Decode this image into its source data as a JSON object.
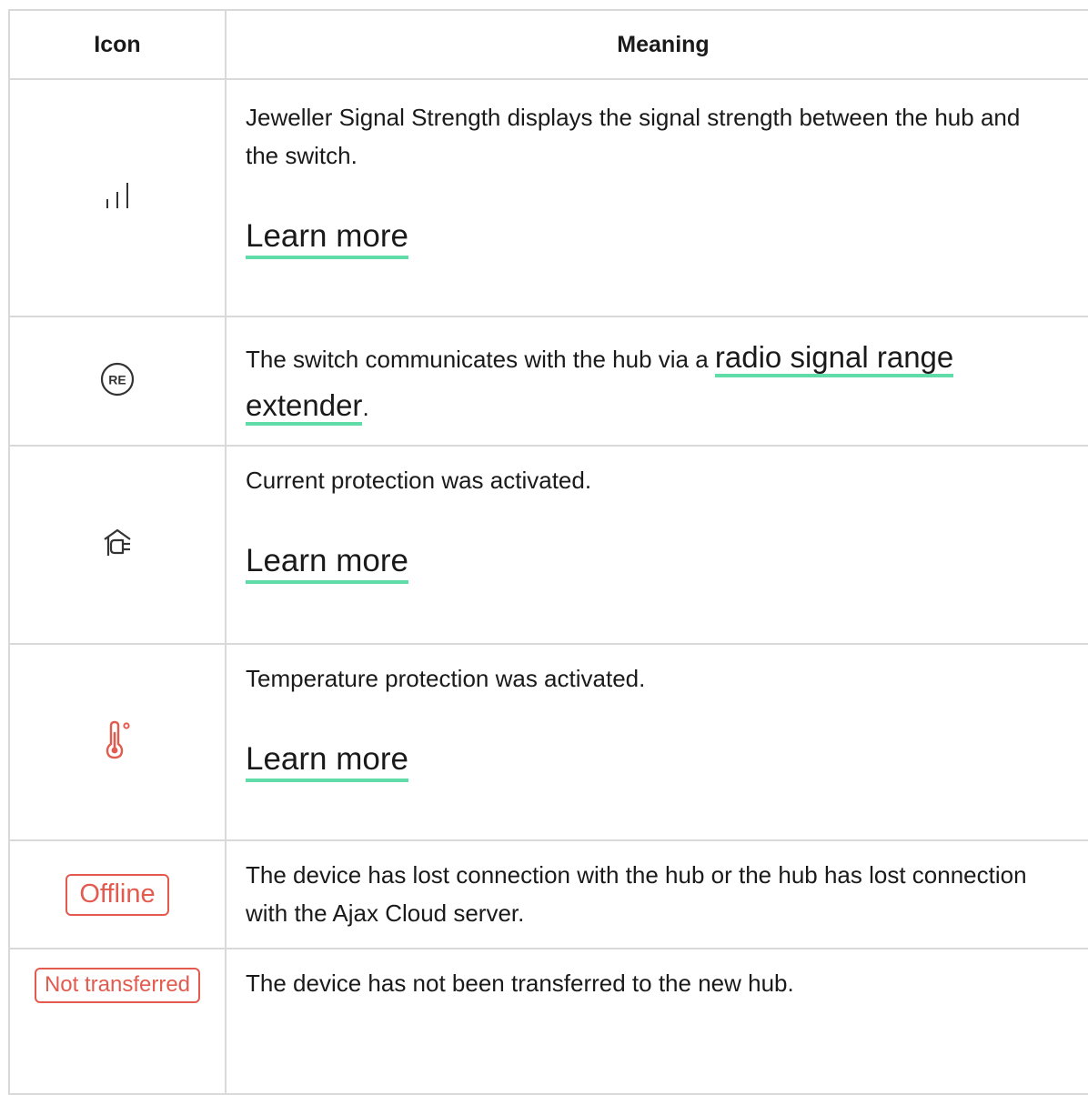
{
  "table": {
    "header": {
      "icon": "Icon",
      "meaning": "Meaning"
    },
    "rows": [
      {
        "icon": "signal-bars-icon",
        "text": "Jeweller Signal Strength displays the signal strength between the hub and the switch.",
        "link": "Learn more"
      },
      {
        "icon": "range-extender-icon",
        "icon_text": "RE",
        "text_before": "The switch communicates with the hub via a ",
        "link": "radio signal range extender",
        "text_after": "."
      },
      {
        "icon": "current-protection-icon",
        "text": "Current protection was activated.",
        "link": "Learn more"
      },
      {
        "icon": "temperature-icon",
        "text": "Temperature protection was activated.",
        "link": "Learn more"
      },
      {
        "badge": "Offline",
        "text": "The device has lost connection with the hub or the hub has lost connection with the Ajax Cloud server."
      },
      {
        "badge": "Not transferred",
        "text": "The device has not been transferred to the new hub."
      }
    ]
  },
  "colors": {
    "border": "#d9d9d9",
    "link_underline": "#5fdca8",
    "alert_red": "#e35b4f",
    "text": "#1a1a1a"
  }
}
